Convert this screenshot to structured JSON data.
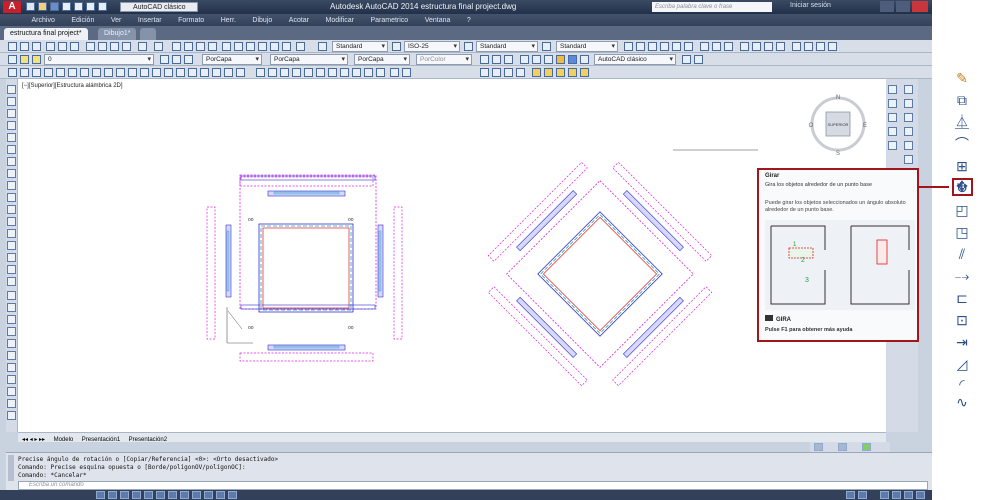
{
  "app": {
    "logo": "A",
    "workspace": "AutoCAD clásico",
    "title": "Autodesk AutoCAD 2014    estructura final project.dwg",
    "search_placeholder": "Escriba palabra clave o frase",
    "login": "Iniciar sesión"
  },
  "menu": [
    "Archivo",
    "Edición",
    "Ver",
    "Insertar",
    "Formato",
    "Herr.",
    "Dibujo",
    "Acotar",
    "Modificar",
    "Parametrico",
    "Ventana",
    "?"
  ],
  "doc_tabs": [
    "estructura final project*",
    "Dibujo1*"
  ],
  "toolbars": {
    "text_style": "Standard",
    "dim_style": "ISO-25",
    "table_style": "Standard",
    "multileader_style": "Standard",
    "workspace_combo": "AutoCAD clásico",
    "layer": "0",
    "color": "PorCapa",
    "linetype": "PorCapa",
    "lineweight": "PorCapa",
    "plotstyle": "PorColor"
  },
  "viewport_label": "[−][Superior][Estructura alámbrica 2D]",
  "viewcube": {
    "face": "SUPERIOR",
    "north": "N",
    "south": "S",
    "east": "E",
    "west": "O"
  },
  "layout_tabs": [
    "Modelo",
    "Presentación1",
    "Presentación2"
  ],
  "command_lines": [
    "Precise ángulo de rotación o [Copiar/Referencia] <0>:  <Orto desactivado>",
    "Comando: Precise esquina opuesta o [Borde/polígonOV/polígonOC]:",
    "Comando: *Cancelar*"
  ],
  "command_placeholder": "Escriba un comando",
  "tooltip": {
    "title": "Girar",
    "description": "Gira los objetos alrededor de un punto base",
    "long": "Puede girar los objetos seleccionados un ángulo absoluto alrededor de un punto base.",
    "command": "GIRA",
    "help": "Pulse F1 para obtener más ayuda",
    "marker_1": "1",
    "marker_2": "2",
    "marker_3": "3"
  },
  "colors": {
    "accent": "#a0161c",
    "magenta": "#e020e0",
    "cyan": "#20a0c0",
    "blue": "#3030d0",
    "red": "#e02020"
  }
}
